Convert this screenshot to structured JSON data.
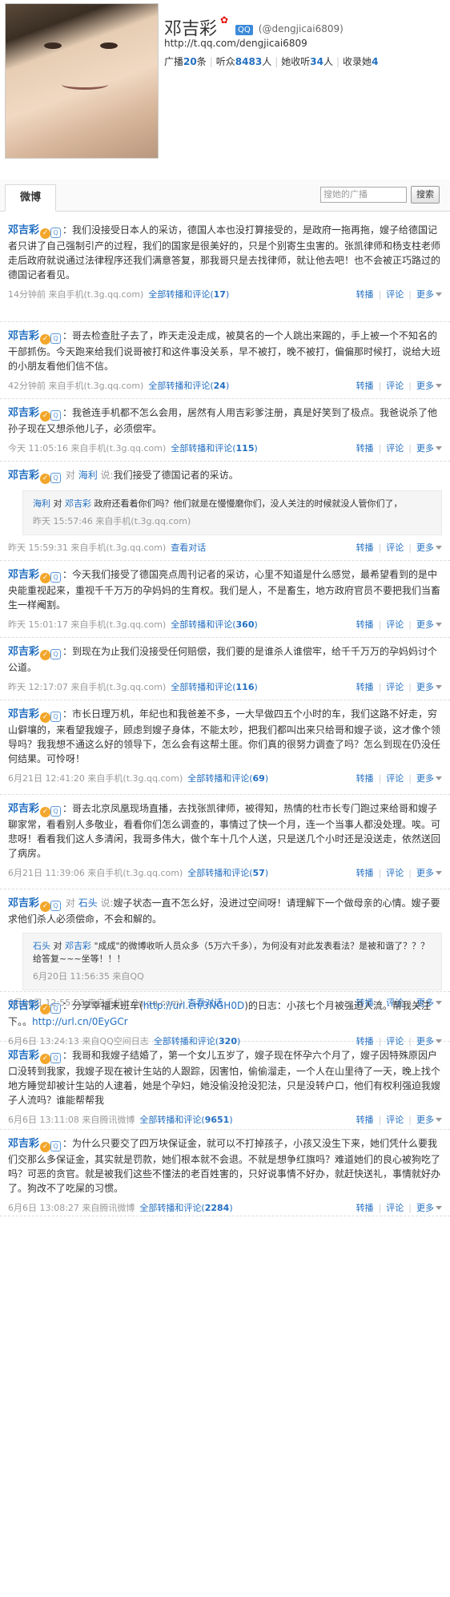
{
  "profile": {
    "name": "邓吉彩",
    "star": "✿",
    "badge": "QQ",
    "handle": "(@dengjicai6809)",
    "url": "http://t.qq.com/dengjicai6809",
    "broadcast_label": "广播",
    "broadcast_count": "20",
    "broadcast_unit": "条",
    "listen_label": "听众",
    "listen_count": "8483",
    "listen_unit": "人",
    "heard_label": "她收听",
    "heard_count": "34",
    "heard_unit": "人",
    "collect_label": "收录她",
    "collect_count": "4"
  },
  "tabs": {
    "weibo": "微博"
  },
  "search": {
    "placeholder": "搜她的广播",
    "button": "搜索"
  },
  "common": {
    "repost": "转播",
    "comment": "评论",
    "more": "更多",
    "all": "全部转播和评论",
    "view": "查看对话",
    "say": "说:",
    "to": "对"
  },
  "posts": [
    {
      "author": "邓吉彩",
      "text": "：我们没接受日本人的采访，德国人本也没打算接受的，是政府一拖再拖，嫂子给德国记者只讲了自己强制引产的过程，我们的国家是很美好的，只是个别寄生虫害的。张凯律师和杨支柱老师走后政府就说通过法律程序还我们满意答复，那我哥只是去找律师，就让他去吧！也不会被正巧路过的德国记者看见。",
      "time": "14分钟前",
      "source": "来自手机(t.3g.qq.com)",
      "count": "17"
    },
    {
      "author": "邓吉彩",
      "text": "：哥去检查肚子去了，昨天走没走成，被莫名的一个人跳出来踢的，手上被一个不知名的干部抓伤。今天跑来给我们说哥被打和这件事没关系，早不被打，晚不被打，偏偏那时候打，说给大班的小朋友看他们信不信。",
      "time": "42分钟前",
      "source": "来自手机(t.3g.qq.com)",
      "count": "24"
    },
    {
      "author": "邓吉彩",
      "text": "：我爸连手机都不怎么会用，居然有人用吉彩爹注册，真是好笑到了极点。我爸说杀了他孙子现在又想杀他儿子，必须偿牢。",
      "time": "今天 11:05:16",
      "source": "来自手机(t.3g.qq.com)",
      "count": "115"
    },
    {
      "author": "邓吉彩",
      "to": "海利",
      "text": "我们接受了德国记者的采访。",
      "quote_author": "海利",
      "quote_to": "邓吉彩",
      "quote_text": "政府还看着你们吗？他们就是在慢慢磨你们，没人关注的时候就没人管你们了，",
      "quote_time": "昨天 15:57:46",
      "quote_source": "来自手机(t.3g.qq.com)",
      "time": "昨天 15:59:31",
      "source": "来自手机(t.3g.qq.com)"
    },
    {
      "author": "邓吉彩",
      "text": "：今天我们接受了德国亮点周刊记者的采访，心里不知道是什么感觉，最希望看到的是中央能重视起来，重视千千万万的孕妈妈的生育权。我们是人，不是畜生，地方政府官员不要把我们当畜生一样阉割。",
      "time": "昨天 15:01:17",
      "source": "来自手机(t.3g.qq.com)",
      "count": "360"
    },
    {
      "author": "邓吉彩",
      "text": "：到现在为止我们没接受任何赔偿，我们要的是谁杀人谁偿牢，给千千万万的孕妈妈讨个公道。",
      "time": "昨天 12:17:07",
      "source": "来自手机(t.3g.qq.com)",
      "count": "116"
    },
    {
      "author": "邓吉彩",
      "text": "：市长日理万机，年纪也和我爸差不多，一大早做四五个小时的车，我们这路不好走，穷山僻壤的，来看望我嫂子，顾虑到嫂子身体，不能太吵，把我们都叫出来只给哥和嫂子谈，这才像个领导吗？我我想不通这么好的领导下，怎么会有这帮土匪。你们真的很努力调查了吗？怎么到现在仍没任何结果。可怜呀！",
      "time": "6月21日 12:41:20",
      "source": "来自手机(t.3g.qq.com)",
      "count": "69"
    },
    {
      "author": "邓吉彩",
      "text": "：哥去北京凤凰现场直播，去找张凯律师，被得知，热情的杜市长专门跑过来给哥和嫂子聊家常，看看别人多敬业，看看你们怎么调查的，事情过了快一个月，连一个当事人都没处理。唉。可悲呀！看看我们这人多清闲，我哥多伟大，做个车十几个人送，只是送几个小时还是没送走，依然送回了病房。",
      "time": "6月21日 11:39:06",
      "source": "来自手机(t.3g.qq.com)",
      "count": "57"
    },
    {
      "author": "邓吉彩",
      "to": "石头",
      "text": "嫂子状态一直不怎么好，没进过空间呀！请理解下一个做母亲的心情。嫂子要求他们杀人必须偿命，不会和解的。",
      "quote_author": "石头",
      "quote_to": "邓吉彩",
      "quote_text": "\"成成\"的微博收听人员众多（5万六千多），为何没有对此发表看法？是被和谐了？？？给答复~~~坐等！！！",
      "quote_time": "6月20日 11:56:35",
      "quote_source": "来自QQ",
      "time": "6月20日 12:55:53",
      "source": "来自手机(t.3g.qq.com)"
    },
    {
      "author": "邓吉彩",
      "text_pre": "：分享幸福末班车(",
      "text_link": "http://url.cn/3NGH0D",
      "text_mid": ")的日志：小孩七个月被强迫人流。帮我关注下。。",
      "text_link2": "http://url.cn/0EyGCr",
      "time": "6月6日 13:24:13",
      "source": "来自QQ空间日志",
      "count": "320"
    },
    {
      "author": "邓吉彩",
      "text": "：我哥和我嫂子结婚了，第一个女儿五岁了，嫂子现在怀孕六个月了，嫂子因特殊原因户口没转到我家，我嫂子现在被计生站的人跟踪，因害怕，偷偷溜走，一个人在山里待了一天，晚上找个地方睡觉却被计生站的人逮着，她是个孕妇，她没偷没抢没犯法，只是没转户口，他们有权利强迫我嫂子人流吗？谁能帮帮我",
      "time": "6月6日 13:11:08",
      "source": "来自腾讯微博",
      "count": "9651"
    },
    {
      "author": "邓吉彩",
      "text": "：为什么只要交了四万块保证金，就可以不打掉孩子，小孩又没生下来，她们凭什么要我们交那么多保证金，其实就是罚款，她们根本就不会退。不就是想争红旗吗？难道她们的良心被狗吃了吗？可恶的贪官。就是被我们这些不懂法的老百姓害的，只好说事情不好办，就赶快送礼，事情就好办了。狗改不了吃屎的习惯。",
      "time": "6月6日 13:08:27",
      "source": "来自腾讯微博",
      "count": "2284"
    }
  ]
}
